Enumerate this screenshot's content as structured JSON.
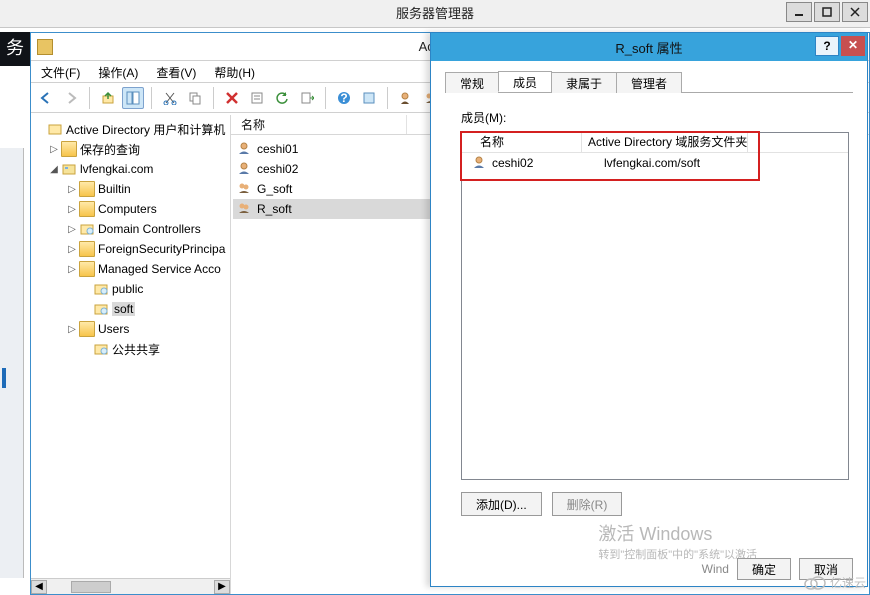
{
  "server_manager": {
    "title": "服务器管理器"
  },
  "left_stub_char": "务",
  "aduc": {
    "title": "Active Dire",
    "menu": {
      "file": "文件(F)",
      "action": "操作(A)",
      "view": "查看(V)",
      "help": "帮助(H)"
    },
    "tree": {
      "root": "Active Directory 用户和计算机",
      "saved_queries": "保存的查询",
      "domain": "lvfengkai.com",
      "nodes": {
        "builtin": "Builtin",
        "computers": "Computers",
        "domain_controllers": "Domain Controllers",
        "fsp": "ForeignSecurityPrincipa",
        "msa": "Managed Service Acco",
        "public": "public",
        "soft": "soft",
        "users": "Users",
        "pubshare": "公共共享"
      }
    },
    "list": {
      "col_name": "名称",
      "items": [
        {
          "name": "ceshi01",
          "type": "user"
        },
        {
          "name": "ceshi02",
          "type": "user"
        },
        {
          "name": "G_soft",
          "type": "group"
        },
        {
          "name": "R_soft",
          "type": "group"
        }
      ],
      "selected": "R_soft"
    }
  },
  "dialog": {
    "title": "R_soft 属性",
    "tabs": {
      "general": "常规",
      "members": "成员",
      "memberof": "隶属于",
      "managedby": "管理者"
    },
    "members_label": "成员(M):",
    "columns": {
      "name": "名称",
      "folder": "Active Directory 域服务文件夹"
    },
    "rows": [
      {
        "name": "ceshi02",
        "folder": "lvfengkai.com/soft"
      }
    ],
    "buttons": {
      "add": "添加(D)...",
      "remove": "删除(R)",
      "ok": "确定",
      "cancel": "取消"
    }
  },
  "activate_windows": {
    "line1": "激活 Windows",
    "line2": "转到\"控制面板\"中的\"系统\"以激活"
  },
  "watermark": "亿速云"
}
